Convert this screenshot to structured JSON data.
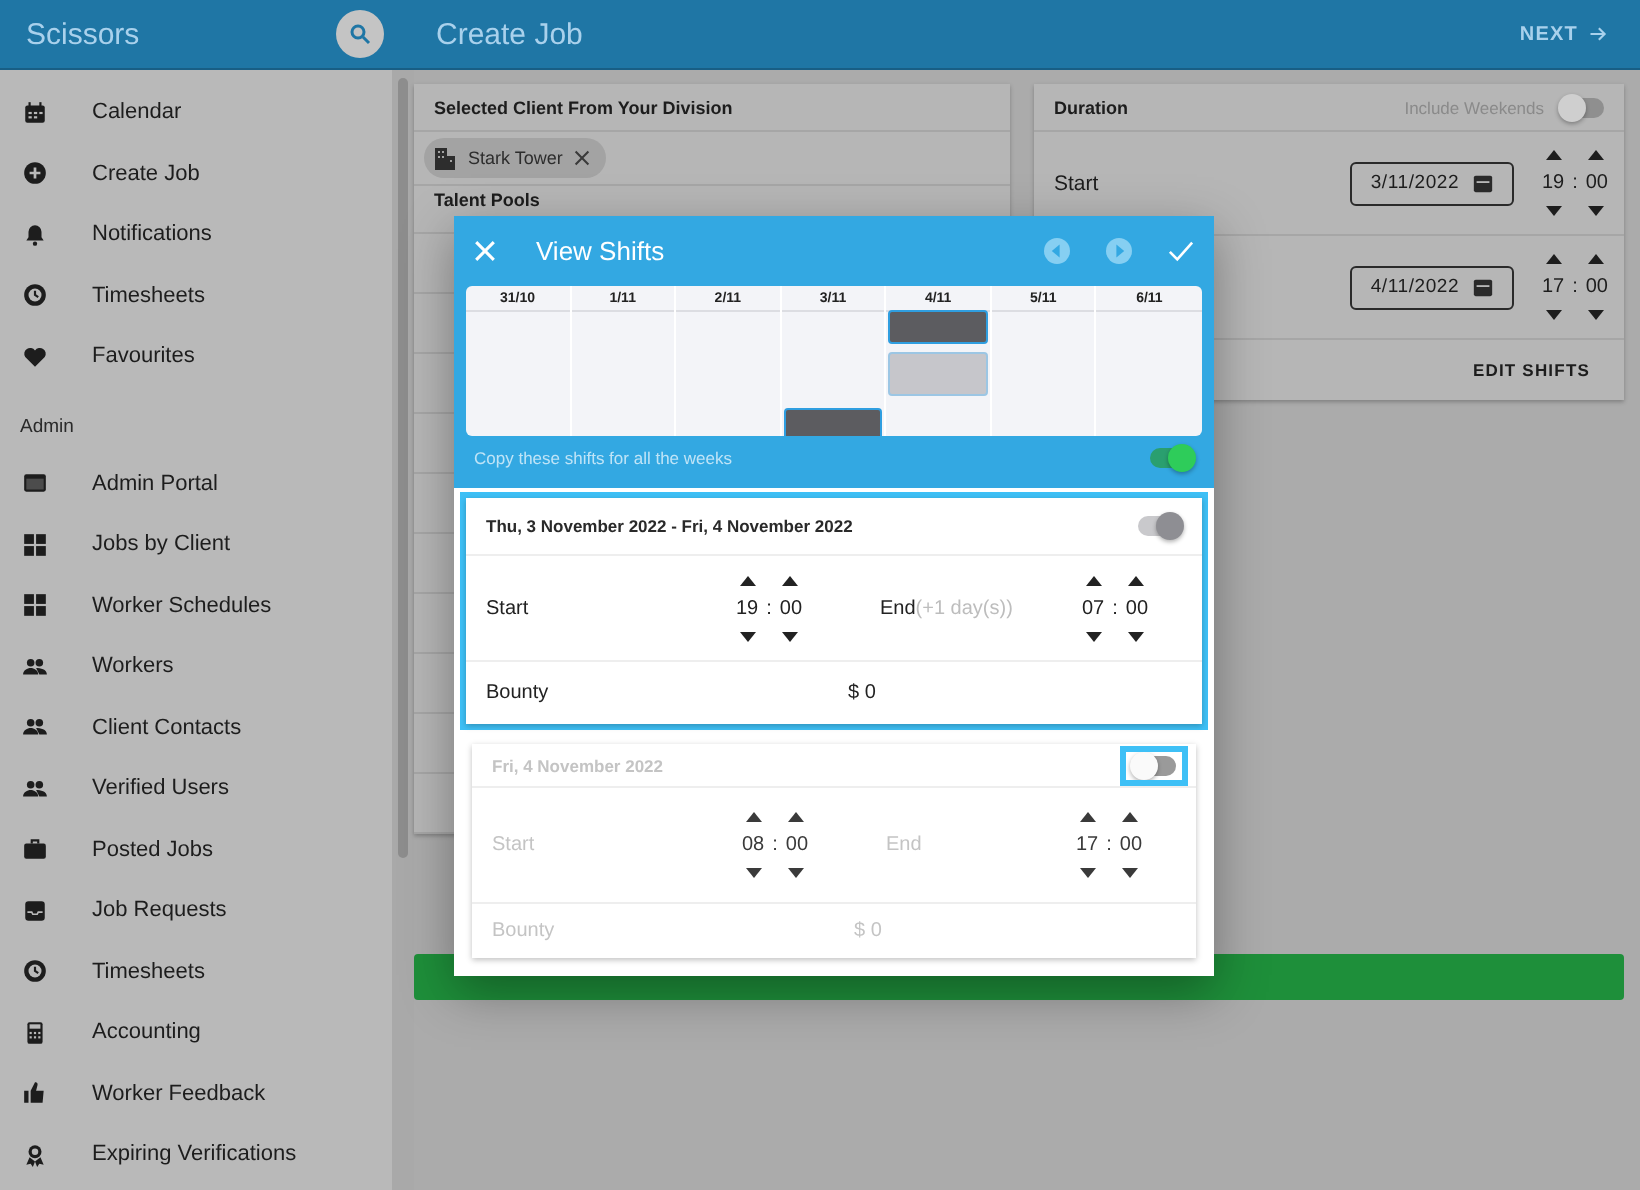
{
  "header": {
    "app_title": "Scissors",
    "page_title": "Create Job",
    "next_label": "NEXT"
  },
  "sidebar": {
    "items": [
      {
        "label": "Calendar"
      },
      {
        "label": "Create Job"
      },
      {
        "label": "Notifications"
      },
      {
        "label": "Timesheets"
      },
      {
        "label": "Favourites"
      }
    ],
    "section_label": "Admin",
    "admin_items": [
      {
        "label": "Admin Portal"
      },
      {
        "label": "Jobs by Client"
      },
      {
        "label": "Worker Schedules"
      },
      {
        "label": "Workers"
      },
      {
        "label": "Client Contacts"
      },
      {
        "label": "Verified Users"
      },
      {
        "label": "Posted Jobs"
      },
      {
        "label": "Job Requests"
      },
      {
        "label": "Timesheets"
      },
      {
        "label": "Accounting"
      },
      {
        "label": "Worker Feedback"
      },
      {
        "label": "Expiring Verifications"
      }
    ]
  },
  "client_card": {
    "title": "Selected Client From Your Division",
    "chip": "Stark Tower",
    "section_title": "Talent Pools"
  },
  "duration_card": {
    "title": "Duration",
    "include_weekends": {
      "label": "Include Weekends",
      "on": false
    },
    "start": {
      "label": "Start",
      "date": "3/11/2022",
      "hour": "19",
      "separator": ":",
      "minute": "00"
    },
    "end": {
      "date": "4/11/2022",
      "hour": "17",
      "separator": ":",
      "minute": "00"
    },
    "edit_shifts": "EDIT SHIFTS"
  },
  "dialog": {
    "title": "View Shifts",
    "calendar": {
      "days": [
        {
          "label": "31/10"
        },
        {
          "label": "1/11"
        },
        {
          "label": "2/11"
        },
        {
          "label": "3/11",
          "shifts": [
            {
              "kind": "lower",
              "enabled": true
            }
          ]
        },
        {
          "label": "4/11",
          "shifts": [
            {
              "kind": "upper",
              "enabled": true
            },
            {
              "kind": "middle",
              "enabled": false
            }
          ]
        },
        {
          "label": "5/11"
        },
        {
          "label": "6/11"
        }
      ]
    },
    "copy_label": "Copy these shifts for all the weeks",
    "copy_all_weeks": true,
    "shifts": [
      {
        "date_label": "Thu, 3 November 2022 - Fri, 4 November 2022",
        "enabled": true,
        "highlighted": true,
        "toggle_highlighted": false,
        "start_label": "Start",
        "start": {
          "hour": "19",
          "separator": ":",
          "minute": "00"
        },
        "end_label": "End",
        "end_note": "(+1 day(s))",
        "end": {
          "hour": "07",
          "separator": ":",
          "minute": "00"
        },
        "bounty_label": "Bounty",
        "bounty": "$ 0"
      },
      {
        "date_label": "Fri, 4 November 2022",
        "enabled": false,
        "highlighted": false,
        "toggle_highlighted": true,
        "start_label": "Start",
        "start": {
          "hour": "08",
          "separator": ":",
          "minute": "00"
        },
        "end_label": "End",
        "end": {
          "hour": "17",
          "separator": ":",
          "minute": "00"
        },
        "bounty_label": "Bounty",
        "bounty": "$ 0"
      }
    ]
  }
}
